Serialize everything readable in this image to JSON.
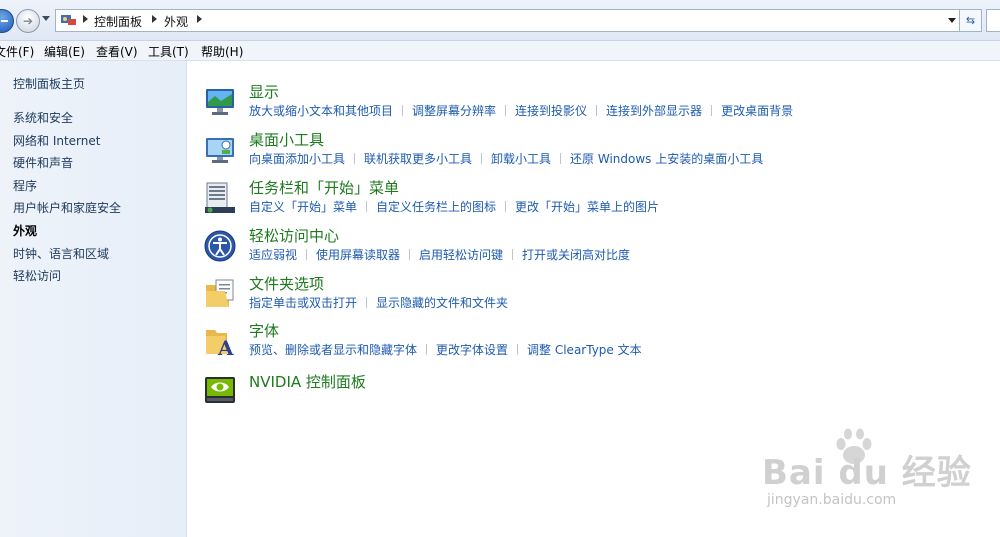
{
  "address_bar": {
    "breadcrumb": [
      "控制面板",
      "外观"
    ]
  },
  "menu": {
    "items": [
      "文件(F)",
      "编辑(E)",
      "查看(V)",
      "工具(T)",
      "帮助(H)"
    ]
  },
  "sidebar": {
    "items": [
      {
        "label": "控制面板主页",
        "current": false
      },
      {
        "label": "系统和安全",
        "current": false
      },
      {
        "label": "网络和 Internet",
        "current": false
      },
      {
        "label": "硬件和声音",
        "current": false
      },
      {
        "label": "程序",
        "current": false
      },
      {
        "label": "用户帐户和家庭安全",
        "current": false
      },
      {
        "label": "外观",
        "current": true
      },
      {
        "label": "时钟、语言和区域",
        "current": false
      },
      {
        "label": "轻松访问",
        "current": false
      }
    ]
  },
  "categories": [
    {
      "title": "显示",
      "icon": "display-icon",
      "links": [
        "放大或缩小文本和其他项目",
        "调整屏幕分辨率",
        "连接到投影仪",
        "连接到外部显示器",
        "更改桌面背景"
      ]
    },
    {
      "title": "桌面小工具",
      "icon": "gadgets-icon",
      "links": [
        "向桌面添加小工具",
        "联机获取更多小工具",
        "卸载小工具",
        "还原 Windows 上安装的桌面小工具"
      ]
    },
    {
      "title": "任务栏和「开始」菜单",
      "icon": "taskbar-icon",
      "links": [
        "自定义「开始」菜单",
        "自定义任务栏上的图标",
        "更改「开始」菜单上的图片"
      ]
    },
    {
      "title": "轻松访问中心",
      "icon": "ease-of-access-icon",
      "links": [
        "适应弱视",
        "使用屏幕读取器",
        "启用轻松访问键",
        "打开或关闭高对比度"
      ]
    },
    {
      "title": "文件夹选项",
      "icon": "folder-options-icon",
      "links": [
        "指定单击或双击打开",
        "显示隐藏的文件和文件夹"
      ]
    },
    {
      "title": "字体",
      "icon": "fonts-icon",
      "links": [
        "预览、删除或者显示和隐藏字体",
        "更改字体设置",
        "调整 ClearType 文本"
      ]
    },
    {
      "title": "NVIDIA 控制面板",
      "icon": "nvidia-icon",
      "links": []
    }
  ],
  "watermark": {
    "brand": "Bai du 经验",
    "url": "jingyan.baidu.com"
  },
  "colors": {
    "link": "#1e5bb0",
    "category_title": "#1e7a1e",
    "sidebar_text": "#1e395b"
  }
}
